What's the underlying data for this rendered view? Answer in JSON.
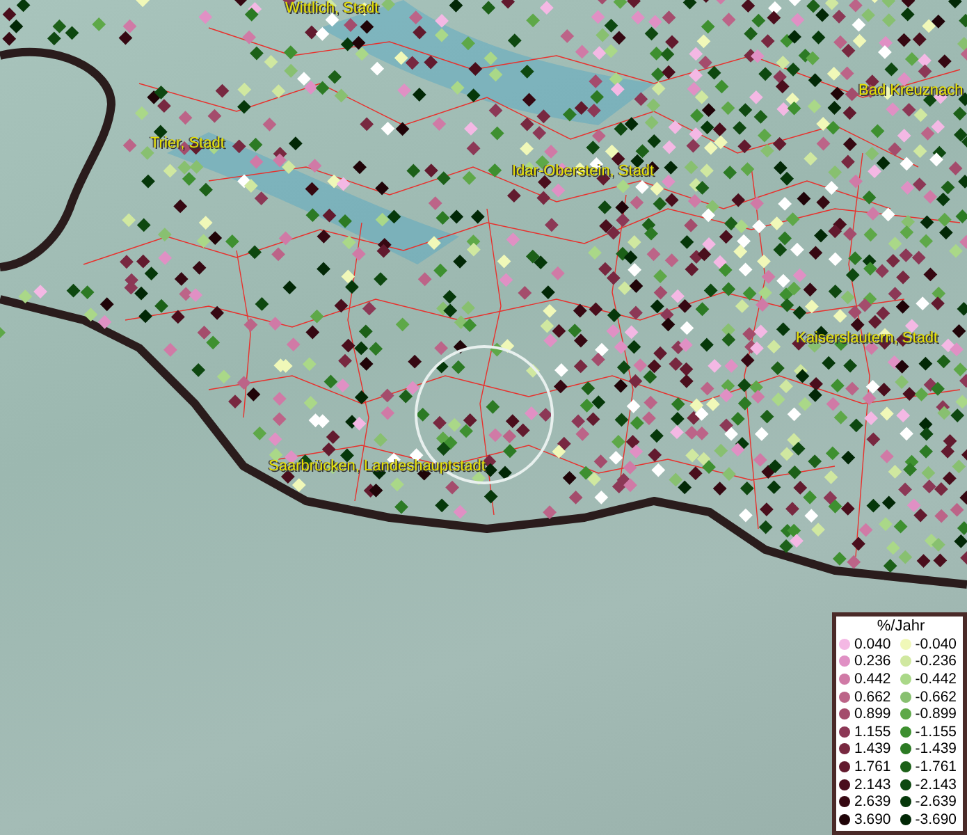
{
  "map": {
    "place_labels": [
      {
        "name": "Wittlich, Stadt"
      },
      {
        "name": "Trier, Stadt"
      },
      {
        "name": "Idar-Oberstein, Stadt"
      },
      {
        "name": "Bad Kreuznach"
      },
      {
        "name": "Kaiserslautern, Stadt"
      },
      {
        "name": "Saarbrücken, Landeshauptstadt"
      }
    ]
  },
  "legend": {
    "title": "%/Jahr",
    "positive": [
      {
        "value": "0.040",
        "color": "#f4b8e4"
      },
      {
        "value": "0.236",
        "color": "#e090c4"
      },
      {
        "value": "0.442",
        "color": "#d07aa6"
      },
      {
        "value": "0.662",
        "color": "#bc6488"
      },
      {
        "value": "0.899",
        "color": "#a44c6c"
      },
      {
        "value": "1.155",
        "color": "#8c3856"
      },
      {
        "value": "1.439",
        "color": "#782840"
      },
      {
        "value": "1.761",
        "color": "#621a2e"
      },
      {
        "value": "2.143",
        "color": "#4a0e1c"
      },
      {
        "value": "2.639",
        "color": "#360812"
      },
      {
        "value": "3.690",
        "color": "#200408"
      }
    ],
    "negative": [
      {
        "value": "-0.040",
        "color": "#f0f8b8"
      },
      {
        "value": "-0.236",
        "color": "#d0e8a0"
      },
      {
        "value": "-0.442",
        "color": "#aad888"
      },
      {
        "value": "-0.662",
        "color": "#88c070"
      },
      {
        "value": "-0.899",
        "color": "#5ea848"
      },
      {
        "value": "-1.155",
        "color": "#3e9030"
      },
      {
        "value": "-1.439",
        "color": "#2c7a24"
      },
      {
        "value": "-1.761",
        "color": "#1c6018"
      },
      {
        "value": "-2.143",
        "color": "#0e4810"
      },
      {
        "value": "-2.639",
        "color": "#06380a"
      },
      {
        "value": "-3.690",
        "color": "#022806"
      }
    ]
  }
}
